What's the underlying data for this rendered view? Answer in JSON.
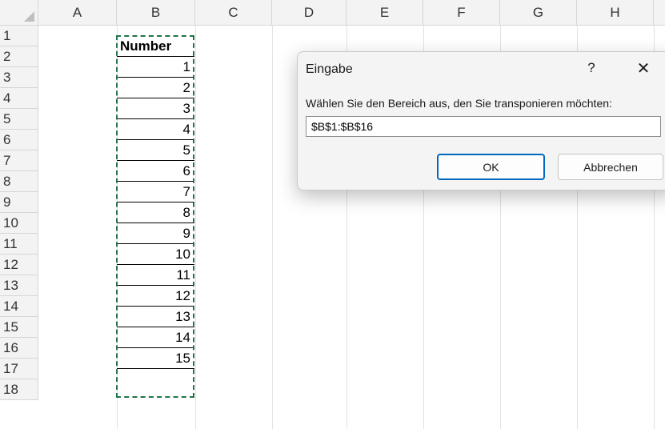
{
  "spreadsheet": {
    "columns": [
      "A",
      "B",
      "C",
      "D",
      "E",
      "F",
      "G",
      "H"
    ],
    "rows": [
      "1",
      "2",
      "3",
      "4",
      "5",
      "6",
      "7",
      "8",
      "9",
      "10",
      "11",
      "12",
      "13",
      "14",
      "15",
      "16",
      "17",
      "18"
    ],
    "column_b": {
      "header": "Number",
      "values": [
        "1",
        "2",
        "3",
        "4",
        "5",
        "6",
        "7",
        "8",
        "9",
        "10",
        "11",
        "12",
        "13",
        "14",
        "15"
      ]
    },
    "accent_color": "#217346"
  },
  "dialog": {
    "title": "Eingabe",
    "help_label": "?",
    "close_label": "✕",
    "prompt": "Wählen Sie den Bereich aus, den Sie transponieren möchten:",
    "input_value": "$B$1:$B$16",
    "ok_label": "OK",
    "cancel_label": "Abbrechen"
  }
}
